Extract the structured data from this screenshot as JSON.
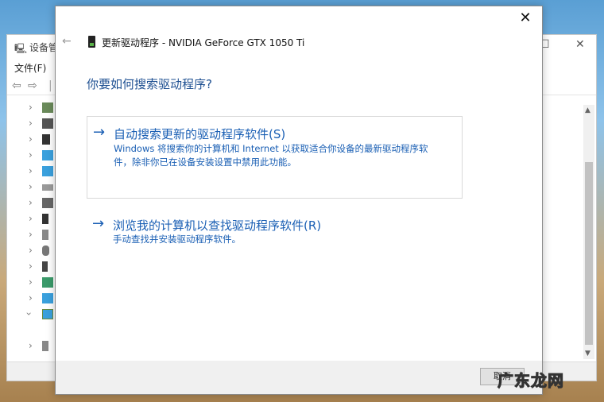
{
  "background_window": {
    "title": "设备管",
    "menu_file": "文件(F)",
    "minimize_glyph": "—",
    "maximize_glyph": "☐",
    "close_glyph": "✕"
  },
  "dialog": {
    "close_glyph": "✕",
    "back_glyph": "←",
    "title": "更新驱动程序 - NVIDIA GeForce GTX 1050 Ti",
    "question": "你要如何搜索驱动程序?",
    "option_auto": {
      "arrow": "→",
      "title": "自动搜索更新的驱动程序软件(S)",
      "description_line1": "Windows 将搜索你的计算机和 Internet 以获取适合你设备的最新驱动程序软",
      "description_line2": "件，除非你已在设备安装设置中禁用此功能。"
    },
    "option_browse": {
      "arrow": "→",
      "title": "浏览我的计算机以查找驱动程序软件(R)",
      "description": "手动查找并安装驱动程序软件。"
    },
    "cancel_label": "取消"
  },
  "watermark": "广东龙网",
  "colors": {
    "accent_link": "#1a5fb4",
    "question_text": "#1d4f91"
  }
}
